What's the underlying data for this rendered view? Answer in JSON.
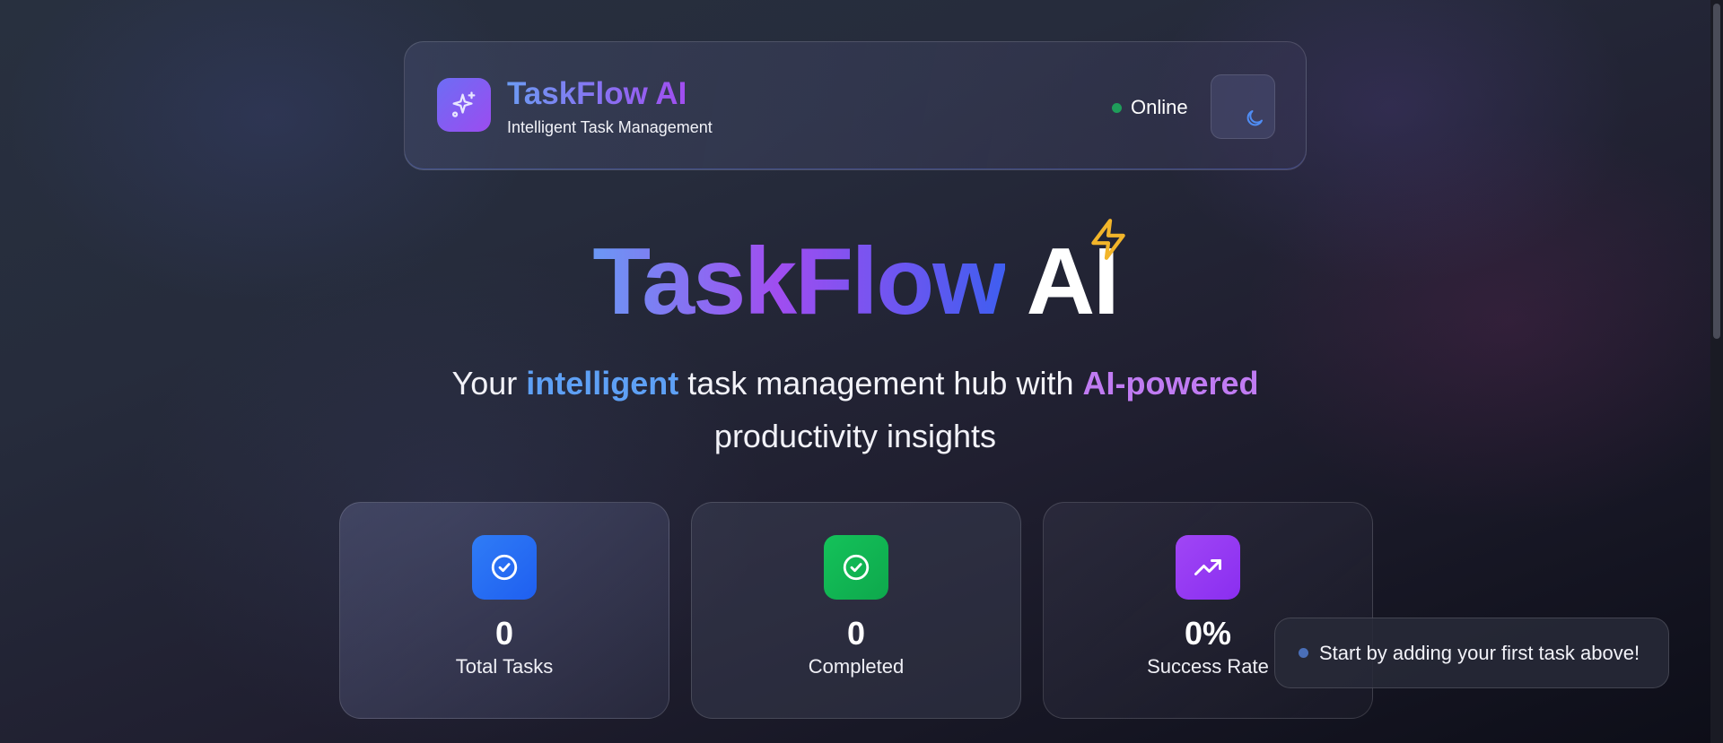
{
  "header": {
    "title": "TaskFlow AI",
    "subtitle": "Intelligent Task Management",
    "logo_icon": "sparkles-icon",
    "status": "Online",
    "status_color": "#1f9d5a",
    "theme_toggle_icon": "moon-icon"
  },
  "hero": {
    "title_gradient": "TaskFlow",
    "title_plain": "AI",
    "badge_icon": "lightning-bolt-icon",
    "tagline": {
      "part1": "Your ",
      "highlight1": "intelligent",
      "part2": " task management hub with ",
      "highlight2": "AI-powered",
      "part3": "productivity insights"
    }
  },
  "stats": [
    {
      "value": "0",
      "label": "Total Tasks",
      "icon": "check-circle-icon",
      "color": "#2f7cf6"
    },
    {
      "value": "0",
      "label": "Completed",
      "icon": "check-circle-icon",
      "color": "#14c25a"
    },
    {
      "value": "0%",
      "label": "Success Rate",
      "icon": "trending-up-icon",
      "color": "#a046f5"
    }
  ],
  "toast": {
    "message": "Start by adding your first task above!"
  }
}
